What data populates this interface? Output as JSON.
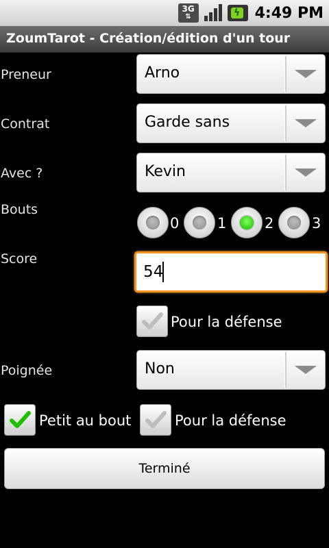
{
  "status_bar": {
    "network": "3G",
    "time": "4:49 PM",
    "icons": [
      "3g-icon",
      "signal-icon",
      "battery-charging-icon"
    ]
  },
  "title": "ZoumTarot - Création/édition d'un tour",
  "form": {
    "preneur": {
      "label": "Preneur",
      "value": "Arno"
    },
    "contrat": {
      "label": "Contrat",
      "value": "Garde sans"
    },
    "avec": {
      "label": "Avec ?",
      "value": "Kevin"
    },
    "bouts": {
      "label": "Bouts",
      "options": [
        "0",
        "1",
        "2",
        "3"
      ],
      "selected": "2"
    },
    "score": {
      "label": "Score",
      "value": "54",
      "defense_label": "Pour la défense",
      "defense_checked": false
    },
    "poignee": {
      "label": "Poignée",
      "value": "Non"
    },
    "petit_au_bout": {
      "label": "Petit au bout",
      "checked": true,
      "defense_label": "Pour la défense",
      "defense_checked": false
    }
  },
  "done_button": "Terminé",
  "colors": {
    "background": "#000000",
    "focus": "#f5931e",
    "check_green": "#1fbf00"
  }
}
